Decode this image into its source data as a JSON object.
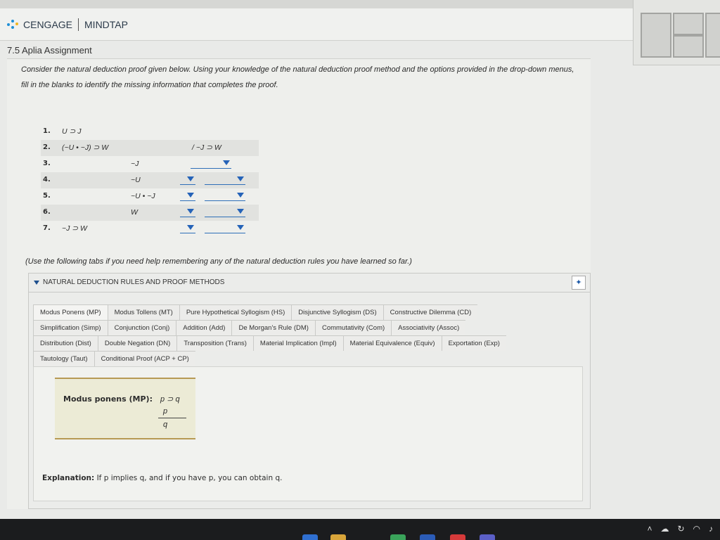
{
  "header": {
    "brand_left": "CENGAGE",
    "brand_right": "MINDTAP"
  },
  "assignment_title": "7.5 Aplia Assignment",
  "instructions": "Consider the natural deduction proof given below. Using your knowledge of the natural deduction proof method and the options provided in the drop-down menus, fill in the blanks to identify the missing information that completes the proof.",
  "proof": {
    "rows": [
      {
        "num": "1.",
        "premise": "U ⊃ J",
        "derived": "",
        "goal": ""
      },
      {
        "num": "2.",
        "premise": "(~U • ~J) ⊃ W",
        "derived": "",
        "goal": "/ ~J ⊃ W"
      },
      {
        "num": "3.",
        "premise": "",
        "derived": "~J",
        "goal": ""
      },
      {
        "num": "4.",
        "premise": "",
        "derived": "~U",
        "goal": ""
      },
      {
        "num": "5.",
        "premise": "",
        "derived": "~U • ~J",
        "goal": ""
      },
      {
        "num": "6.",
        "premise": "",
        "derived": "W",
        "goal": ""
      },
      {
        "num": "7.",
        "premise": "~J ⊃ W",
        "derived": "",
        "goal": ""
      }
    ]
  },
  "help_text": "(Use the following tabs if you need help remembering any of the natural deduction rules you have learned so far.)",
  "panel": {
    "title": "NATURAL DEDUCTION RULES AND PROOF METHODS",
    "pin_icon": "pin-icon",
    "tabs_row1": [
      "Modus Ponens (MP)",
      "Modus Tollens (MT)",
      "Pure Hypothetical Syllogism (HS)",
      "Disjunctive Syllogism (DS)",
      "Constructive Dilemma (CD)"
    ],
    "tabs_row2": [
      "Simplification (Simp)",
      "Conjunction (Conj)",
      "Addition (Add)",
      "De Morgan's Rule (DM)",
      "Commutativity (Com)",
      "Associativity (Assoc)"
    ],
    "tabs_row3": [
      "Distribution (Dist)",
      "Double Negation (DN)",
      "Transposition (Trans)",
      "Material Implication (Impl)",
      "Material Equivalence (Equiv)",
      "Exportation (Exp)"
    ],
    "tabs_row4": [
      "Tautology (Taut)",
      "Conditional Proof (ACP + CP)"
    ]
  },
  "rule": {
    "name": "Modus ponens (MP):",
    "line1": "p ⊃ q",
    "line2": "p",
    "line3": "q",
    "explanation_label": "Explanation:",
    "explanation": "If p implies q, and if you have p, you can obtain q."
  }
}
